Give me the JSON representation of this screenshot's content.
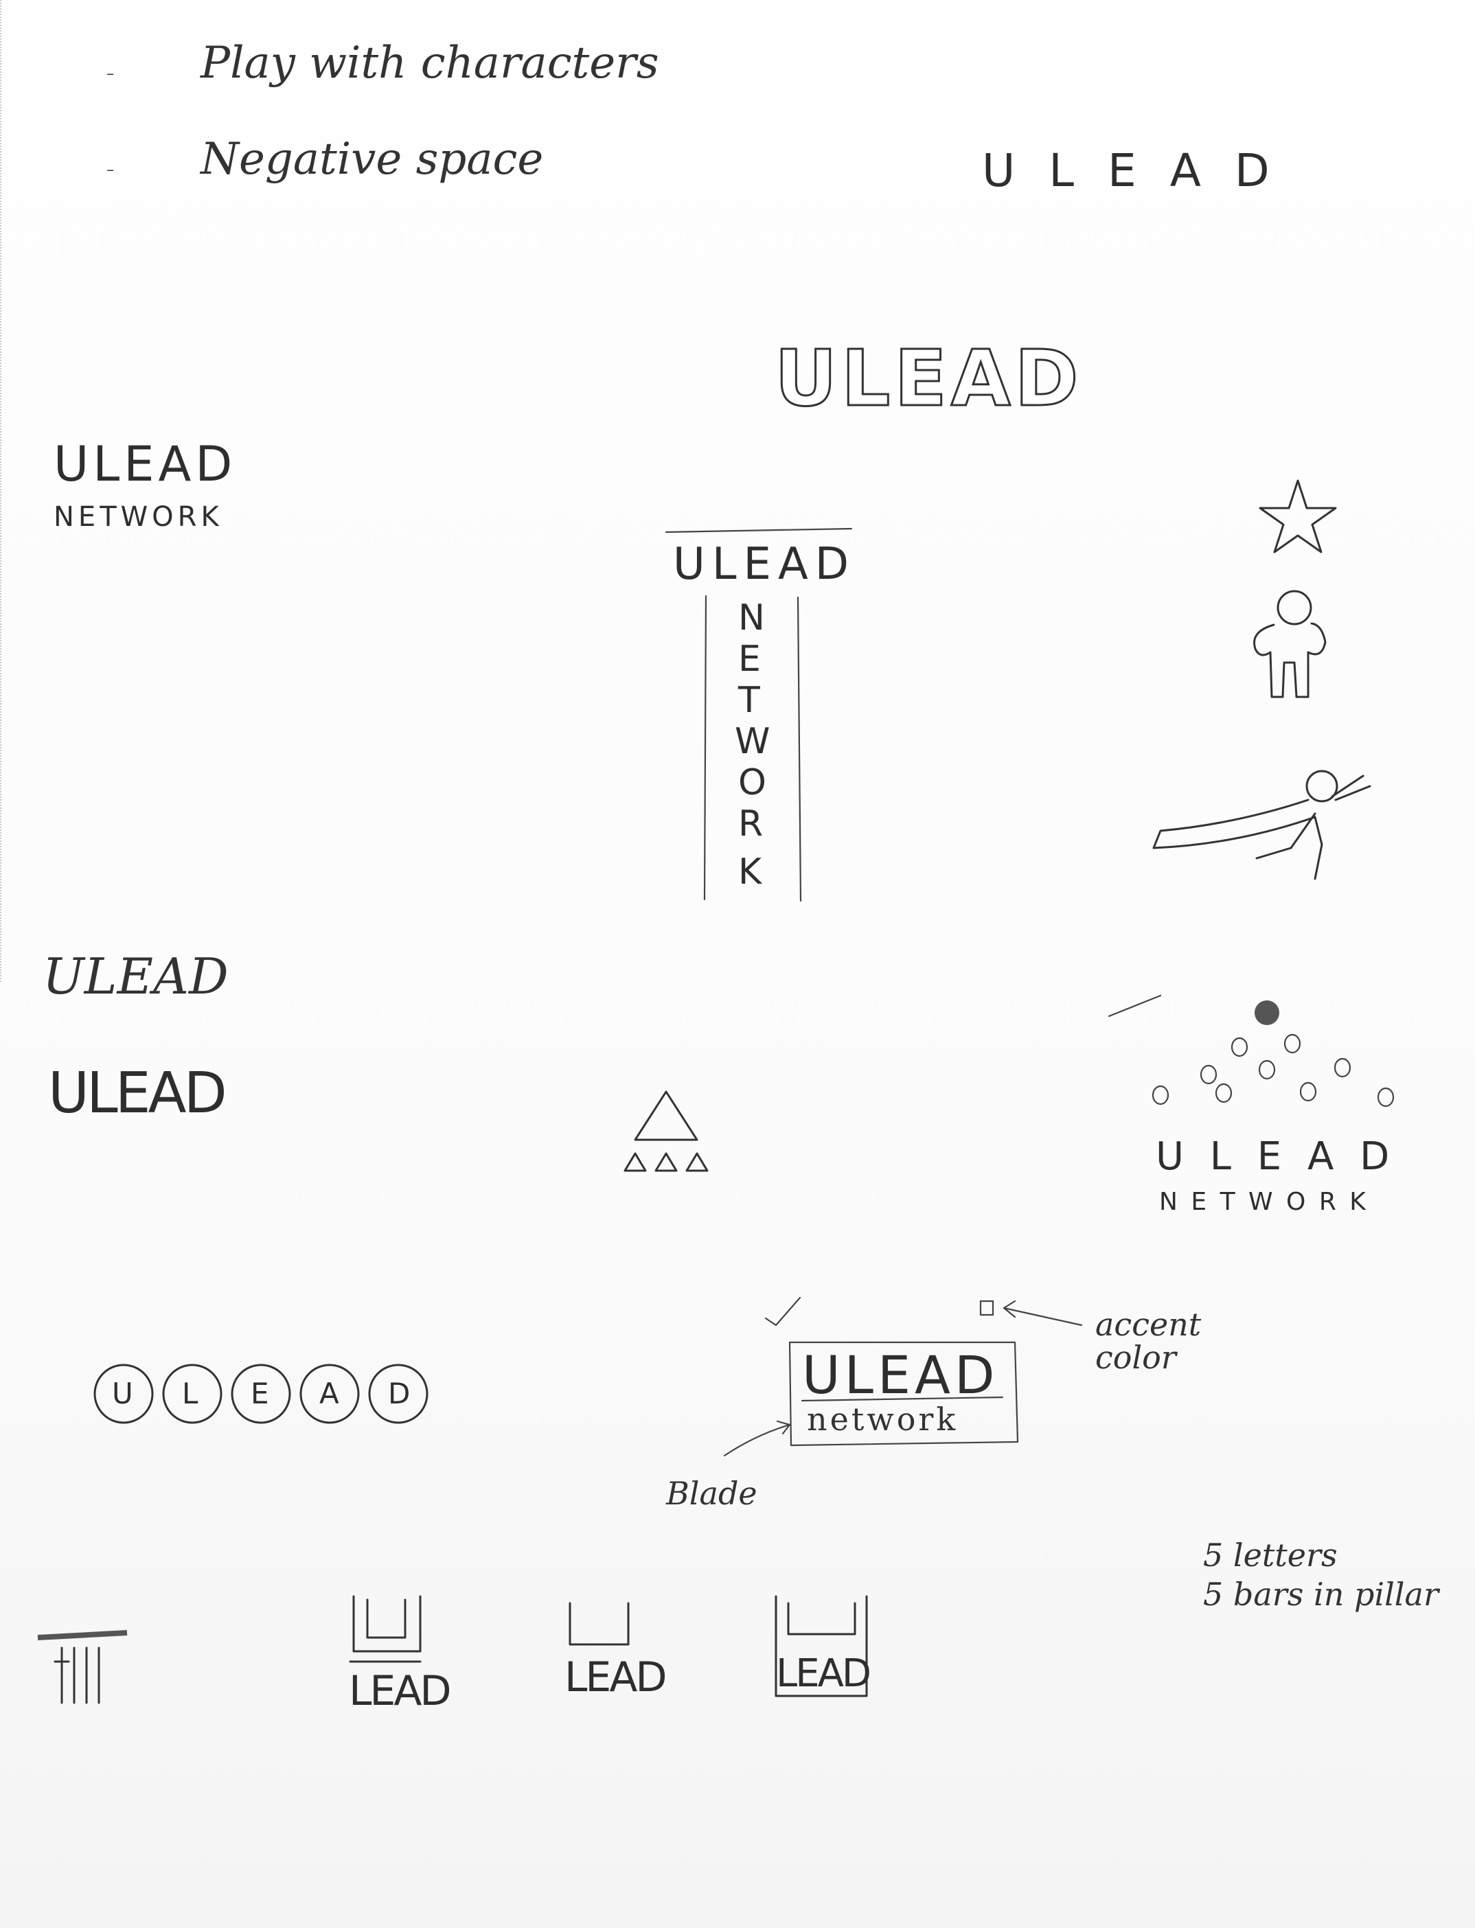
{
  "notes": {
    "line1": "Play with characters",
    "line2": "Negative space"
  },
  "sketches": {
    "spaced_wordmark": "U L E A D",
    "outlined_wordmark": "ULEAD",
    "stacked_left": {
      "word": "ULEAD",
      "sub": "NETWORK"
    },
    "pillar": {
      "word": "ULEAD",
      "vertical": [
        "N",
        "E",
        "T",
        "W",
        "O",
        "R",
        "K"
      ]
    },
    "script_variant": "ULEAD",
    "merged_variant": "ULEAD",
    "circles": [
      "U",
      "L",
      "E",
      "A",
      "D"
    ],
    "dots_logo": {
      "word": "U L E A D",
      "sub": "N E T W O R K"
    },
    "box_logo": {
      "word": "ULEAD",
      "sub": "network"
    },
    "annotation_accent": "accent color",
    "annotation_blade": "Blade",
    "footnote_line1": "5 letters",
    "footnote_line2": "5 bars in pillar",
    "bottom_row": [
      "LEAD",
      "LEAD",
      "LEAD"
    ]
  }
}
